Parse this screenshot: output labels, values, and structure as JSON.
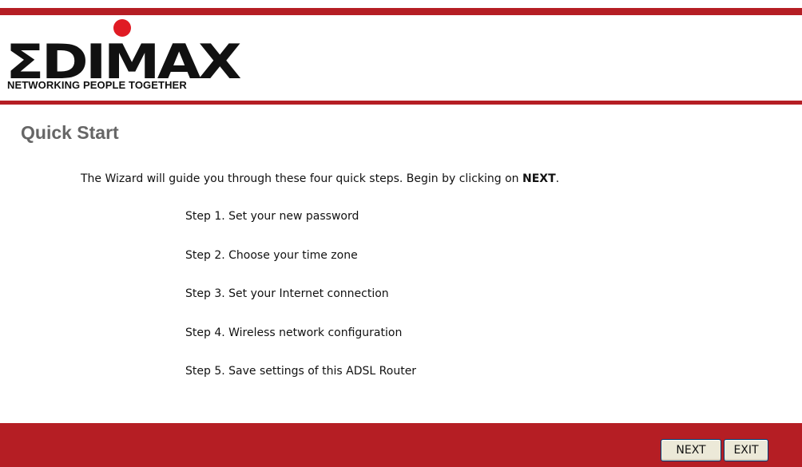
{
  "logo": {
    "brand": "EDIMAX",
    "tagline": "NETWORKING PEOPLE TOGETHER",
    "dot_color": "#e01b24"
  },
  "colors": {
    "accent": "#b51e24",
    "title": "#666666"
  },
  "page": {
    "title": "Quick Start",
    "intro_text": "The Wizard will guide you through these four quick steps. Begin by clicking on ",
    "intro_bold": "NEXT",
    "intro_end": "."
  },
  "steps": [
    "Step 1. Set your new password",
    "Step 2. Choose your time zone",
    "Step 3. Set your Internet connection",
    "Step 4. Wireless network configuration",
    "Step 5. Save settings of this ADSL Router"
  ],
  "buttons": {
    "next": "NEXT",
    "exit": "EXIT"
  }
}
